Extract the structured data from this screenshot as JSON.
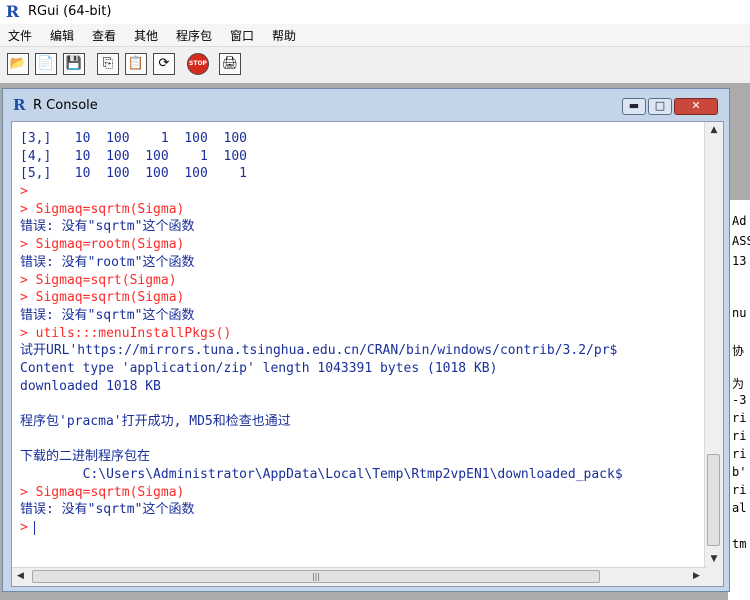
{
  "app": {
    "title": "RGui (64-bit)"
  },
  "menu": [
    "文件",
    "编辑",
    "查看",
    "其他",
    "程序包",
    "窗口",
    "帮助"
  ],
  "toolbar": [
    {
      "name": "open-script-icon",
      "glyph": "📂"
    },
    {
      "name": "load-workspace-icon",
      "glyph": "📄"
    },
    {
      "name": "save-workspace-icon",
      "glyph": "💾"
    },
    {
      "name": "copy-icon",
      "glyph": "⎘"
    },
    {
      "name": "paste-icon",
      "glyph": "📋"
    },
    {
      "name": "copy-paste-icon",
      "glyph": "⟳"
    },
    {
      "name": "stop-icon",
      "glyph": "STOP"
    },
    {
      "name": "print-icon",
      "glyph": "🖨"
    }
  ],
  "console": {
    "title": "R Console",
    "lines": [
      {
        "t": "[3,]   10  100    1  100  100",
        "c": "o"
      },
      {
        "t": "[4,]   10  100  100    1  100",
        "c": "o"
      },
      {
        "t": "[5,]   10  100  100  100    1",
        "c": "o"
      },
      {
        "t": ">",
        "c": "p"
      },
      {
        "t": "> Sigmaq=sqrtm(Sigma)",
        "c": "p"
      },
      {
        "t": "错误: 没有\"sqrtm\"这个函数",
        "c": "o"
      },
      {
        "t": "> Sigmaq=rootm(Sigma)",
        "c": "p"
      },
      {
        "t": "错误: 没有\"rootm\"这个函数",
        "c": "o"
      },
      {
        "t": "> Sigmaq=sqrt(Sigma)",
        "c": "p"
      },
      {
        "t": "> Sigmaq=sqrtm(Sigma)",
        "c": "p"
      },
      {
        "t": "错误: 没有\"sqrtm\"这个函数",
        "c": "o"
      },
      {
        "t": "> utils:::menuInstallPkgs()",
        "c": "p"
      },
      {
        "t": "试开URL'https://mirrors.tuna.tsinghua.edu.cn/CRAN/bin/windows/contrib/3.2/pr$",
        "c": "o"
      },
      {
        "t": "Content type 'application/zip' length 1043391 bytes (1018 KB)",
        "c": "o"
      },
      {
        "t": "downloaded 1018 KB",
        "c": "o"
      },
      {
        "t": "",
        "c": "blank"
      },
      {
        "t": "程序包'pracma'打开成功, MD5和检查也通过",
        "c": "o"
      },
      {
        "t": "",
        "c": "blank"
      },
      {
        "t": "下载的二进制程序包在",
        "c": "o"
      },
      {
        "t": "        C:\\Users\\Administrator\\AppData\\Local\\Temp\\Rtmp2vpEN1\\downloaded_pack$",
        "c": "o"
      },
      {
        "t": "> Sigmaq=sqrtm(Sigma)",
        "c": "p"
      },
      {
        "t": "错误: 没有\"sqrtm\"这个函数",
        "c": "o"
      }
    ],
    "prompt": ">"
  },
  "background_window": [
    "Ad",
    "ASS",
    " 13",
    "",
    "nu",
    "",
    "协",
    "",
    "为",
    "-3",
    "ri",
    "ri",
    "ri",
    "b'",
    "ri",
    "al",
    "",
    "tm"
  ]
}
